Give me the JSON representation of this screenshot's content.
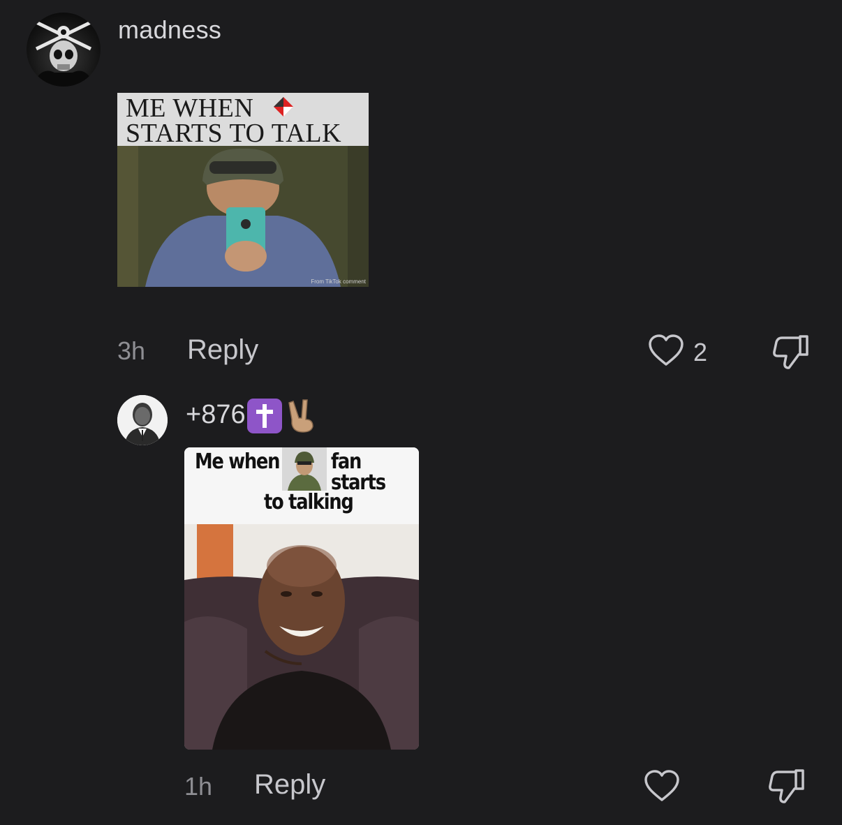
{
  "comments": [
    {
      "username": "madness",
      "meme_caption_line1": "ME WHEN",
      "meme_caption_line2": "STARTS TO TALK",
      "meme_watermark": "From TikTok comment",
      "time": "3h",
      "reply_label": "Reply",
      "like_count": "2",
      "icons": {
        "like": "heart-outline-icon",
        "dislike": "thumbs-down-icon"
      }
    },
    {
      "username": "+876",
      "emojis": [
        "latin-cross-emoji",
        "victory-hand-emoji"
      ],
      "meme_caption_part1": "Me when a",
      "meme_caption_part2": "fan starts",
      "meme_caption_line2": "to talking",
      "time": "1h",
      "reply_label": "Reply",
      "like_count": "",
      "icons": {
        "like": "heart-outline-icon",
        "dislike": "thumbs-down-icon"
      }
    }
  ],
  "colors": {
    "background": "#1c1c1e",
    "username": "#d8d8dc",
    "meta": "#8e8e93",
    "reply": "#c7c7cc",
    "cross_emoji": "#8e55c8"
  }
}
